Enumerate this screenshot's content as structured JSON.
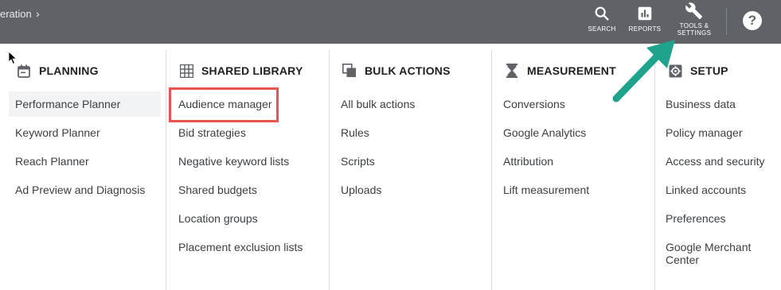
{
  "topbar": {
    "breadcrumb": "eration",
    "breadcrumb_chevron": "›",
    "search_label": "SEARCH",
    "reports_label": "REPORTS",
    "tools_label_line1": "TOOLS &",
    "tools_label_line2": "SETTINGS",
    "help_glyph": "?"
  },
  "columns": [
    {
      "title": "PLANNING",
      "icon": "calendar-icon",
      "items": [
        "Performance Planner",
        "Keyword Planner",
        "Reach Planner",
        "Ad Preview and Diagnosis"
      ]
    },
    {
      "title": "SHARED LIBRARY",
      "icon": "grid-icon",
      "items": [
        "Audience manager",
        "Bid strategies",
        "Negative keyword lists",
        "Shared budgets",
        "Location groups",
        "Placement exclusion lists"
      ]
    },
    {
      "title": "BULK ACTIONS",
      "icon": "copy-icon",
      "items": [
        "All bulk actions",
        "Rules",
        "Scripts",
        "Uploads"
      ]
    },
    {
      "title": "MEASUREMENT",
      "icon": "hourglass-icon",
      "items": [
        "Conversions",
        "Google Analytics",
        "Attribution",
        "Lift measurement"
      ]
    },
    {
      "title": "SETUP",
      "icon": "settings-icon",
      "items": [
        "Business data",
        "Policy manager",
        "Access and security",
        "Linked accounts",
        "Preferences",
        "Google Merchant",
        "Center"
      ]
    }
  ],
  "colors": {
    "topbar": "#5f6368",
    "highlight": "#e8554b",
    "arrow": "#1fa38c",
    "selected": "#f1f3f4"
  }
}
